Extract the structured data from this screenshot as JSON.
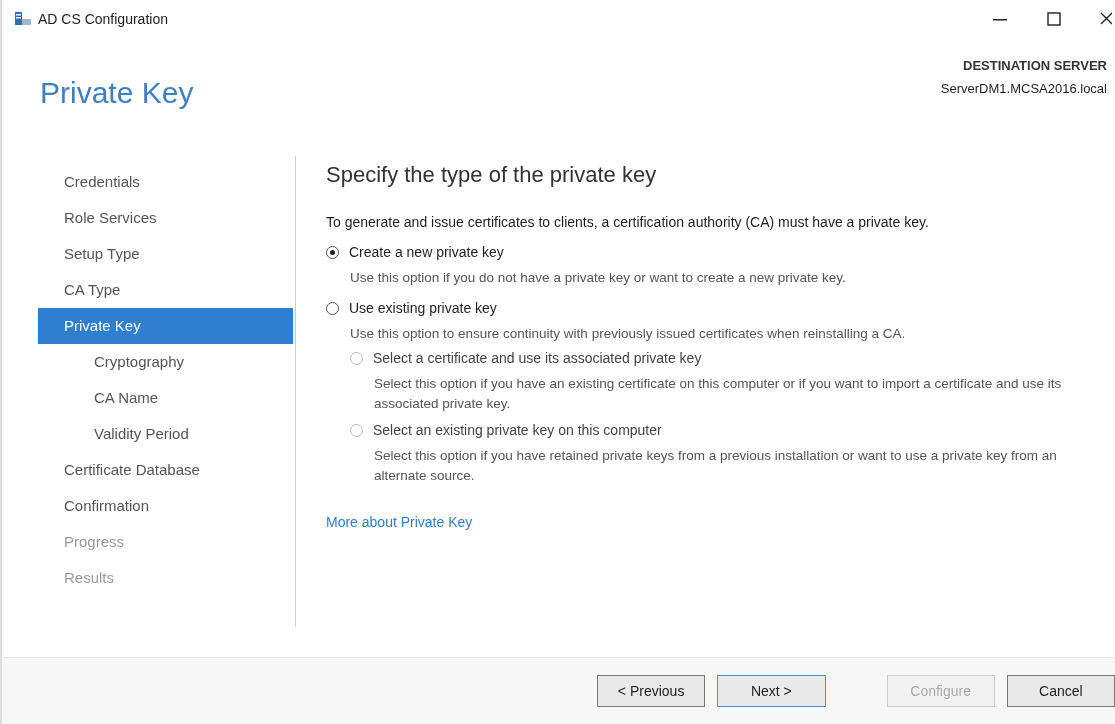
{
  "window": {
    "title": "AD CS Configuration"
  },
  "page_title": "Private Key",
  "destination": {
    "label": "DESTINATION SERVER",
    "server": "ServerDM1.MCSA2016.local"
  },
  "sidebar": {
    "items": [
      {
        "label": "Credentials",
        "selected": false,
        "disabled": false
      },
      {
        "label": "Role Services",
        "selected": false,
        "disabled": false
      },
      {
        "label": "Setup Type",
        "selected": false,
        "disabled": false
      },
      {
        "label": "CA Type",
        "selected": false,
        "disabled": false
      },
      {
        "label": "Private Key",
        "selected": true,
        "disabled": false,
        "children": [
          {
            "label": "Cryptography",
            "selected": false,
            "disabled": false
          },
          {
            "label": "CA Name",
            "selected": false,
            "disabled": false
          },
          {
            "label": "Validity Period",
            "selected": false,
            "disabled": false
          }
        ]
      },
      {
        "label": "Certificate Database",
        "selected": false,
        "disabled": false
      },
      {
        "label": "Confirmation",
        "selected": false,
        "disabled": false
      },
      {
        "label": "Progress",
        "selected": false,
        "disabled": true
      },
      {
        "label": "Results",
        "selected": false,
        "disabled": true
      }
    ]
  },
  "content": {
    "heading": "Specify the type of the private key",
    "intro": "To generate and issue certificates to clients, a certification authority (CA) must have a private key.",
    "options": [
      {
        "label": "Create a new private key",
        "description": "Use this option if you do not have a private key or want to create a new private key.",
        "selected": true,
        "disabled": false
      },
      {
        "label": "Use existing private key",
        "description": "Use this option to ensure continuity with previously issued certificates when reinstalling a CA.",
        "selected": false,
        "disabled": false,
        "children": [
          {
            "label": "Select a certificate and use its associated private key",
            "description": "Select this option if you have an existing certificate on this computer or if you want to import a certificate and use its associated private key.",
            "selected": false,
            "disabled": true
          },
          {
            "label": "Select an existing private key on this computer",
            "description": "Select this option if you have retained private keys from a previous installation or want to use a private key from an alternate source.",
            "selected": false,
            "disabled": true
          }
        ]
      }
    ],
    "link": "More about Private Key"
  },
  "buttons": [
    {
      "label": "< Previous",
      "disabled": false,
      "focused": false
    },
    {
      "label": "Next >",
      "disabled": false,
      "focused": true
    },
    {
      "label": "Configure",
      "disabled": true,
      "focused": false
    },
    {
      "label": "Cancel",
      "disabled": false,
      "focused": false
    }
  ]
}
